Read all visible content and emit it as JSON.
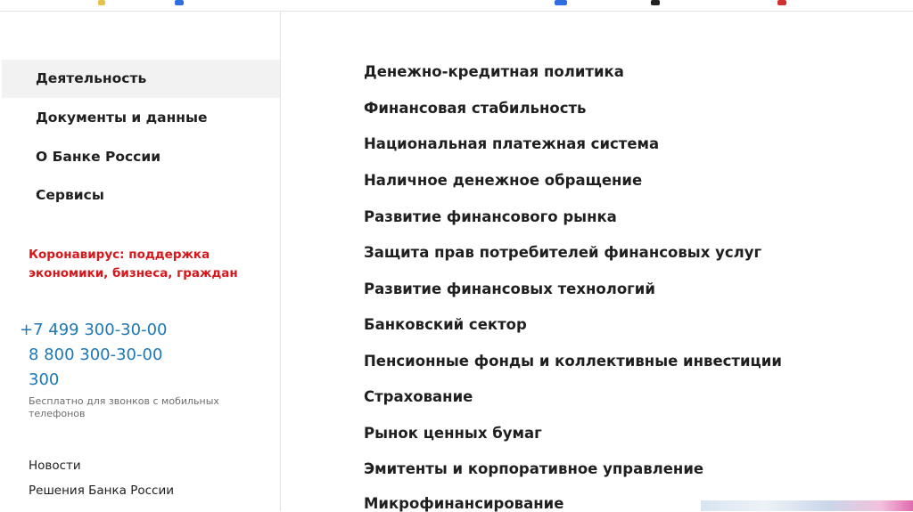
{
  "sidebar": {
    "nav": [
      {
        "label": "Деятельность",
        "active": true
      },
      {
        "label": "Документы и данные",
        "active": false
      },
      {
        "label": "О Банке России",
        "active": false
      },
      {
        "label": "Сервисы",
        "active": false
      }
    ],
    "covid": {
      "line1": "Коронавирус: поддержка",
      "line2": "экономики, бизнеса, граждан"
    },
    "phones": [
      "+7 499 300-30-00",
      "8 800 300-30-00",
      "300"
    ],
    "phone_note": "Бесплатно для звонков с мобильных телефонов",
    "links": [
      "Новости",
      "Решения Банка России"
    ]
  },
  "main": {
    "menu": [
      "Денежно-кредитная политика",
      "Финансовая стабильность",
      "Национальная платежная система",
      "Наличное денежное обращение",
      "Развитие финансового рынка",
      "Защита прав потребителей финансовых услуг",
      "Развитие финансовых технологий",
      "Банковский сектор",
      "Пенсионные фонды и коллективные инвестиции",
      "Страхование",
      "Рынок ценных бумаг",
      "Эмитенты и корпоративное управление",
      "Микрофинансирование"
    ]
  },
  "colors": {
    "accent": "#1d78b5",
    "alert": "#d6171b",
    "active_bg": "#f2f2f2"
  }
}
